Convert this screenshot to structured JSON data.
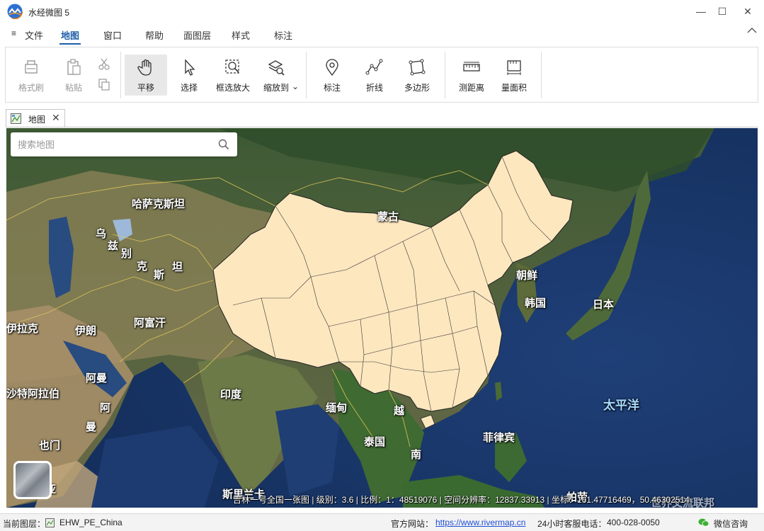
{
  "window": {
    "title": "水经微图 5",
    "minimize_glyph": "—",
    "maximize_glyph": "☐",
    "close_glyph": "✕"
  },
  "menu": {
    "hamburger": "≡",
    "items": [
      "文件",
      "地图",
      "窗口",
      "帮助",
      "面图层",
      "样式",
      "标注"
    ],
    "active": "地图",
    "collapse_glyph": "^"
  },
  "ribbon": {
    "format_painter": "格式刷",
    "paste": "粘贴",
    "pan": "平移",
    "select": "选择",
    "box_zoom": "框选放大",
    "zoom_to": "缩放到",
    "zoom_to_arrow": "⌄",
    "marker": "标注",
    "polyline": "折线",
    "polygon": "多边形",
    "measure_distance": "测距离",
    "measure_area": "量面积"
  },
  "doc_tab": {
    "label": "地图",
    "close_glyph": "✕"
  },
  "search": {
    "placeholder": "搜索地图"
  },
  "map_labels": {
    "kazakhstan": "哈萨克斯坦",
    "mongolia": "蒙古",
    "uzbekistan_1": "乌",
    "uzbekistan_2": "兹",
    "uzbekistan_3": "别",
    "uzbekistan_4": "克",
    "uzbekistan_5": "斯",
    "uzbekistan_6": "坦",
    "iraq": "伊拉克",
    "iran": "伊朗",
    "afghanistan": "阿富汗",
    "oman": "阿曼",
    "saudi": "沙特阿拉伯",
    "yemen": "也门",
    "oman2_1": "阿",
    "oman2_2": "曼",
    "india": "印度",
    "myanmar": "缅甸",
    "vietnam_1": "越",
    "vietnam_2": "南",
    "thailand": "泰国",
    "north_korea": "朝鲜",
    "south_korea": "韩国",
    "japan": "日本",
    "philippines": "菲律宾",
    "pacific": "太平洋",
    "sri_lanka": "斯里兰卡",
    "brunei": "帕劳",
    "watermark": "世界交流联邦",
    "somalia": "亚"
  },
  "map_status": {
    "text": "吉林一号全国一张图 | 级别：3.6 | 比例：1：48519076 | 空间分辨率：12837.33913 | 坐标：161.47716469，50.46302514"
  },
  "statusbar": {
    "current_layer_label": "当前图层：",
    "current_layer_value": "EHW_PE_China",
    "website_label": "官方网站：",
    "website_url": "https://www.rivermap.cn",
    "hotline_label": "24小时客服电话：",
    "hotline_value": "400-028-0050",
    "wechat": "微信咨询"
  },
  "colors": {
    "accent": "#1e5fa8",
    "china_fill": "#fde7bf",
    "link": "#1f4fd6"
  }
}
